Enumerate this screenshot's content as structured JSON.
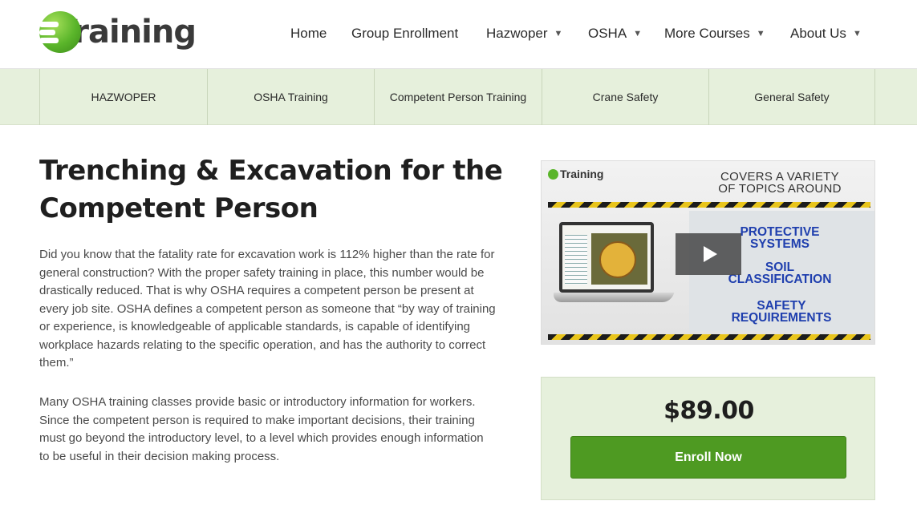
{
  "brand": {
    "logo_text": "Training",
    "accent": "#5ab52a"
  },
  "nav": {
    "items": [
      {
        "label": "Home",
        "dropdown": false
      },
      {
        "label": "Group Enrollment",
        "dropdown": false
      },
      {
        "label": "Hazwoper",
        "dropdown": true
      },
      {
        "label": "OSHA",
        "dropdown": true
      },
      {
        "label": "More Courses",
        "dropdown": true
      },
      {
        "label": "About Us",
        "dropdown": true
      }
    ],
    "caret": "▼"
  },
  "categories": [
    "HAZWOPER",
    "OSHA Training",
    "Competent Person Training",
    "Crane Safety",
    "General Safety"
  ],
  "main": {
    "title": "Trenching & Excavation for the Competent Person",
    "paragraph1": "Did you know that the fatality rate for excavation work is 112% higher than the rate for general construction?  With the proper safety training in place, this number would be drastically reduced.  That is why OSHA requires a competent person be present at every job site.  OSHA defines a competent person as someone that “by way of training or experience, is knowledgeable of applicable standards, is capable of identifying workplace hazards relating to the specific operation, and has the authority to correct them.”",
    "paragraph2": "Many OSHA training classes provide basic or introductory information for workers.  Since the competent person is required to make important decisions, their training must go beyond the introductory level, to a level which provides enough information to be useful in their decision making process."
  },
  "video": {
    "logo_text": "Training",
    "heading_line1": "COVERS A VARIETY",
    "heading_line2": "OF TOPICS AROUND",
    "topics": [
      {
        "line1": "PROTECTIVE",
        "line2": "SYSTEMS"
      },
      {
        "line1": "SOIL",
        "line2": "CLASSIFICATION"
      },
      {
        "line1": "SAFETY",
        "line2": "REQUIREMENTS"
      }
    ]
  },
  "purchase": {
    "price": "$89.00",
    "enroll_label": "Enroll Now",
    "button_color": "#4e9a22"
  }
}
